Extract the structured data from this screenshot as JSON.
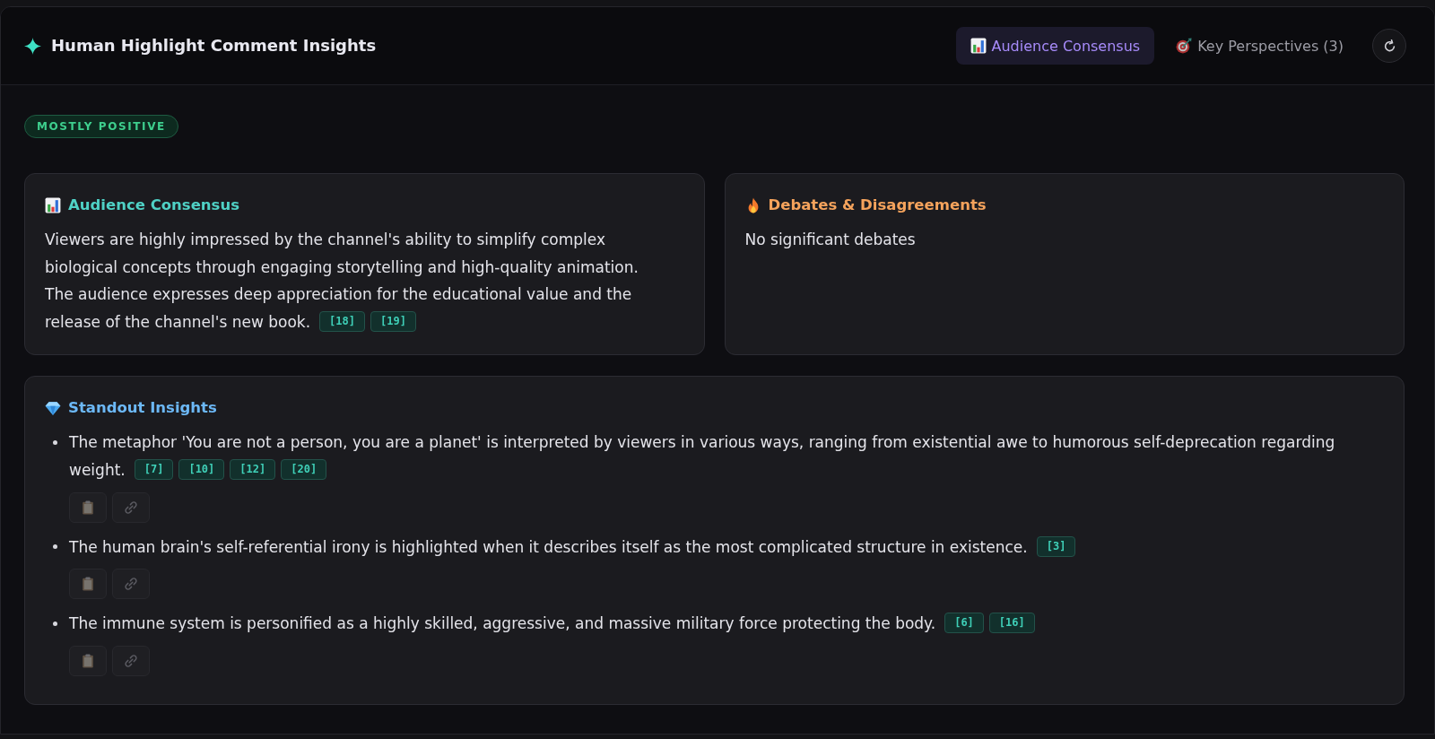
{
  "header": {
    "title": "Human Highlight Comment Insights",
    "tabs": [
      {
        "kind": "consensus",
        "label": "Audience Consensus",
        "selected": true
      },
      {
        "kind": "perspectives",
        "label": "Key Perspectives (3)",
        "selected": false
      }
    ]
  },
  "sentiment": {
    "kind": "positive",
    "label": "MOSTLY POSITIVE"
  },
  "sections": [
    {
      "kind": "consensus",
      "title": "Audience Consensus",
      "text": "Viewers are highly impressed by the channel's ability to simplify complex biological concepts through engaging storytelling and high-quality animation. The audience expresses deep appreciation for the educational value and the release of the channel's new book.",
      "citations": [
        "[18]",
        "[19]"
      ]
    },
    {
      "kind": "debates",
      "title": "Debates & Disagreements",
      "text": "No significant debates"
    },
    {
      "kind": "insights",
      "title": "Standout Insights",
      "items": [
        {
          "text": "The metaphor 'You are not a person, you are a planet' is interpreted by viewers in various ways, ranging from existential awe to humorous self-deprecation regarding weight.",
          "citations": [
            "[7]",
            "[10]",
            "[12]",
            "[20]"
          ]
        },
        {
          "text": "The human brain's self-referential irony is highlighted when it describes itself as the most complicated structure in existence.",
          "citations": [
            "[3]"
          ]
        },
        {
          "text": "The immune system is personified as a highly skilled, aggressive, and massive military force protecting the body.",
          "citations": [
            "[6]",
            "[16]"
          ]
        }
      ]
    }
  ]
}
